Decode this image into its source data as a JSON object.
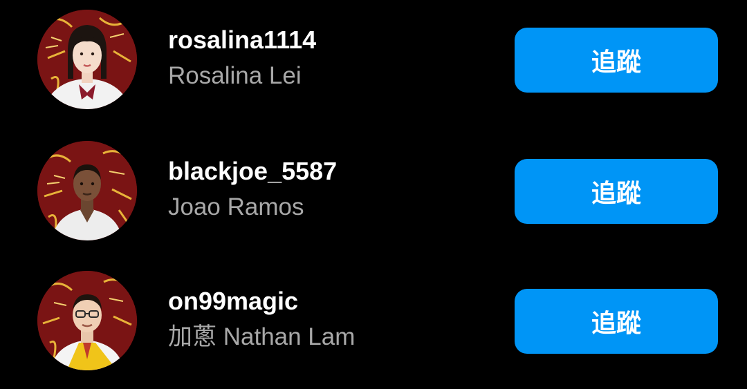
{
  "suggestions": [
    {
      "username": "rosalina1114",
      "full_name": "Rosalina Lei",
      "follow_label": "追蹤",
      "avatar_icon": "profile-photo-woman"
    },
    {
      "username": "blackjoe_5587",
      "full_name": "Joao Ramos",
      "follow_label": "追蹤",
      "avatar_icon": "profile-photo-man"
    },
    {
      "username": "on99magic",
      "full_name": "加蔥 Nathan Lam",
      "follow_label": "追蹤",
      "avatar_icon": "profile-photo-man-glasses"
    }
  ],
  "colors": {
    "background": "#000000",
    "username": "#ffffff",
    "full_name": "#a8a8a8",
    "follow_button": "#0095f6",
    "avatar_background": "#7a1414"
  }
}
